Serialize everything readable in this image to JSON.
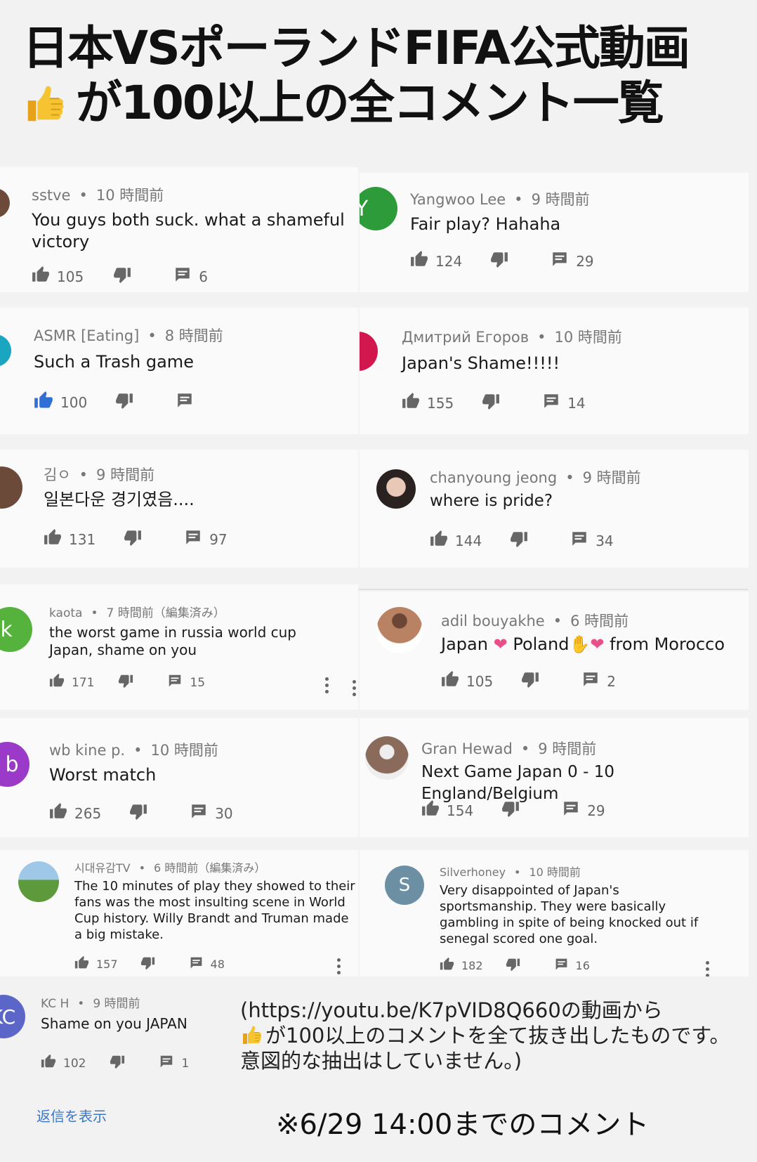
{
  "header": {
    "line1": "日本VSポーランドFIFA公式動画",
    "line2": "が100以上の全コメント一覧",
    "thumb_icon": "thumbs-up-emoji"
  },
  "colors": {
    "like_active": "#2f6fd6",
    "avatar_green": "#2e9b3a",
    "avatar_red": "#d2174f",
    "avatar_cyan": "#1aa6c0",
    "avatar_lime": "#55b23d",
    "avatar_purple": "#9b39c8",
    "avatar_gray": "#6d8fa3",
    "avatar_indigo": "#5c66c9"
  },
  "comments": [
    {
      "author": "sstve",
      "time": "10 時間前",
      "text": "You guys both suck. what a shameful\nvictory",
      "likes": "105",
      "replies": "6"
    },
    {
      "author": "Yangwoo Lee",
      "time": "9 時間前",
      "text": "Fair play? Hahaha",
      "likes": "124",
      "replies": "29",
      "avatar_letter": "Y"
    },
    {
      "author": "ASMR [Eating]",
      "time": "8 時間前",
      "text": "Such a Trash game",
      "likes": "100",
      "replies": ""
    },
    {
      "author": "Дмитрий Егоров",
      "time": "10 時間前",
      "text": "Japan's Shame!!!!!",
      "likes": "155",
      "replies": "14"
    },
    {
      "author": "김ㅇ",
      "time": "9 時間前",
      "text": "일본다운 경기였음....",
      "likes": "131",
      "replies": "97"
    },
    {
      "author": "chanyoung jeong",
      "time": "9 時間前",
      "text": "where is pride?",
      "likes": "144",
      "replies": "34"
    },
    {
      "author": "kaota",
      "time": "7 時間前（編集済み）",
      "text": "the worst game in russia world cup\nJapan, shame on you",
      "likes": "171",
      "replies": "15",
      "avatar_letter": "k"
    },
    {
      "author": "adil bouyakhe",
      "time": "6 時間前",
      "text_a": "Japan",
      "text_b": "Poland",
      "text_c": "from Morocco",
      "likes": "105",
      "replies": "2"
    },
    {
      "author": "wb kine p.",
      "time": "10 時間前",
      "text": "Worst match",
      "likes": "265",
      "replies": "30",
      "avatar_letter": "b"
    },
    {
      "author": "Gran Hewad",
      "time": "9 時間前",
      "text": "Next Game Japan 0 - 10 England/Belgium",
      "likes": "154",
      "replies": "29"
    },
    {
      "author": "시대유감TV",
      "time": "6 時間前（編集済み）",
      "text": "The 10 minutes of play they showed to their\nfans was the most insulting scene in World\nCup history. Willy Brandt and Truman made\na big mistake.",
      "likes": "157",
      "replies": "48"
    },
    {
      "author": "Silverhoney",
      "time": "10 時間前",
      "text": "Very disappointed of Japan's\nsportsmanship. They were basically\ngambling in spite of being knocked out if\nsenegal scored one goal.",
      "likes": "182",
      "replies": "16",
      "avatar_letter": "S"
    },
    {
      "author": "KC H",
      "time": "9 時間前",
      "text": "Shame on you JAPAN",
      "likes": "102",
      "replies": "1",
      "avatar_letter": "KC"
    }
  ],
  "show_replies": "返信を表示",
  "note": {
    "line1": "(https://youtu.be/K7pVID8Q660の動画から",
    "line2": "が100以上のコメントを全て抜き出したものです。",
    "line3": "意図的な抽出はしていません。)"
  },
  "deadline": "※6/29 14:00までのコメント"
}
